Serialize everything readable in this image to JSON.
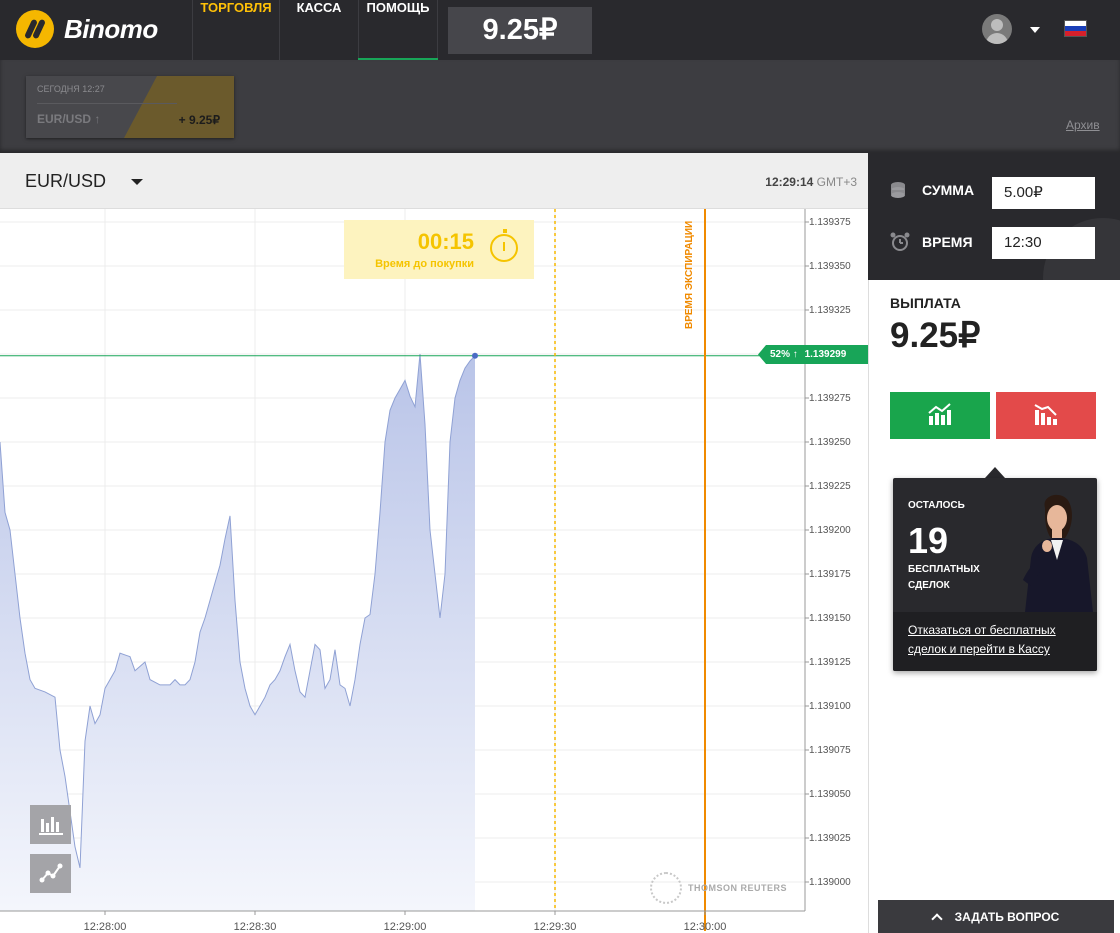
{
  "header": {
    "logo_text": "Binomo",
    "nav": [
      {
        "label": "ТОРГОВЛЯ"
      },
      {
        "label": "КАССА"
      },
      {
        "label": "ПОМОЩЬ"
      }
    ],
    "balance": "9.25₽"
  },
  "history": {
    "deal": {
      "time": "СЕГОДНЯ 12:27",
      "pair": "EUR/USD ↑",
      "profit": "+ 9.25₽"
    },
    "archive_label": "Архив"
  },
  "chart_header": {
    "pair": "EUR/USD",
    "time": "12:29:14",
    "tz": "GMT+3"
  },
  "chart": {
    "purchase_timer": {
      "value": "00:15",
      "label": "Время до покупки"
    },
    "expiration_label": "ВРЕМЯ ЭКСПИРАЦИИ",
    "price_tag": {
      "percent": "52% ↑",
      "price": "1.139299"
    },
    "watermark": "THOMSON REUTERS",
    "colors": {
      "area": "#c3cdea",
      "line": "#8fa1d4",
      "current_line": "#18a558",
      "expiry": "#f08a00",
      "purchase": "#f5b700"
    }
  },
  "chart_data": {
    "type": "area",
    "title": "",
    "xlabel": "",
    "ylabel": "",
    "ylim": [
      1.13899,
      1.139385
    ],
    "y_ticks": [
      "1.139375",
      "1.139350",
      "1.139325",
      "1.139300",
      "1.139275",
      "1.139250",
      "1.139225",
      "1.139200",
      "1.139175",
      "1.139150",
      "1.139125",
      "1.139100",
      "1.139075",
      "1.139050",
      "1.139025",
      "1.139000"
    ],
    "x_ticks": [
      "12:28:00",
      "12:28:30",
      "12:29:00",
      "12:29:30",
      "12:30:00"
    ],
    "grid": true,
    "current_price": 1.139299,
    "purchase_deadline": "12:29:30",
    "expiration_time": "12:30:00",
    "series": [
      {
        "values": [
          [
            "12:27:39",
            1.13925
          ],
          [
            "12:27:40",
            1.13921
          ],
          [
            "12:27:41",
            1.1392
          ],
          [
            "12:27:42",
            1.139175
          ],
          [
            "12:27:43",
            1.13915
          ],
          [
            "12:27:44",
            1.13913
          ],
          [
            "12:27:45",
            1.139115
          ],
          [
            "12:27:46",
            1.13911
          ],
          [
            "12:27:48",
            1.139108
          ],
          [
            "12:27:50",
            1.139105
          ],
          [
            "12:27:51",
            1.139075
          ],
          [
            "12:27:52",
            1.13906
          ],
          [
            "12:27:53",
            1.13904
          ],
          [
            "12:27:54",
            1.13902
          ],
          [
            "12:27:55",
            1.139008
          ],
          [
            "12:27:56",
            1.13908
          ],
          [
            "12:27:57",
            1.1391
          ],
          [
            "12:27:58",
            1.13909
          ],
          [
            "12:27:59",
            1.139095
          ],
          [
            "12:28:00",
            1.13911
          ],
          [
            "12:28:01",
            1.139115
          ],
          [
            "12:28:02",
            1.13912
          ],
          [
            "12:28:03",
            1.13913
          ],
          [
            "12:28:05",
            1.139128
          ],
          [
            "12:28:06",
            1.13912
          ],
          [
            "12:28:08",
            1.139125
          ],
          [
            "12:28:09",
            1.139115
          ],
          [
            "12:28:11",
            1.139112
          ],
          [
            "12:28:13",
            1.139112
          ],
          [
            "12:28:14",
            1.139115
          ],
          [
            "12:28:15",
            1.139112
          ],
          [
            "12:28:16",
            1.139112
          ],
          [
            "12:28:17",
            1.139115
          ],
          [
            "12:28:18",
            1.139125
          ],
          [
            "12:28:19",
            1.139142
          ],
          [
            "12:28:20",
            1.13915
          ],
          [
            "12:28:21",
            1.13916
          ],
          [
            "12:28:22",
            1.13917
          ],
          [
            "12:28:23",
            1.13918
          ],
          [
            "12:28:24",
            1.139195
          ],
          [
            "12:28:25",
            1.139208
          ],
          [
            "12:28:26",
            1.13916
          ],
          [
            "12:28:27",
            1.139125
          ],
          [
            "12:28:28",
            1.13911
          ],
          [
            "12:28:29",
            1.1391
          ],
          [
            "12:28:30",
            1.139095
          ],
          [
            "12:28:31",
            1.1391
          ],
          [
            "12:28:32",
            1.139105
          ],
          [
            "12:28:33",
            1.139112
          ],
          [
            "12:28:34",
            1.139115
          ],
          [
            "12:28:35",
            1.13912
          ],
          [
            "12:28:36",
            1.139128
          ],
          [
            "12:28:37",
            1.139135
          ],
          [
            "12:28:38",
            1.13912
          ],
          [
            "12:28:39",
            1.139108
          ],
          [
            "12:28:40",
            1.139105
          ],
          [
            "12:28:41",
            1.13912
          ],
          [
            "12:28:42",
            1.139135
          ],
          [
            "12:28:43",
            1.139132
          ],
          [
            "12:28:44",
            1.13911
          ],
          [
            "12:28:45",
            1.139115
          ],
          [
            "12:28:46",
            1.139132
          ],
          [
            "12:28:47",
            1.139112
          ],
          [
            "12:28:48",
            1.13911
          ],
          [
            "12:28:49",
            1.1391
          ],
          [
            "12:28:50",
            1.139115
          ],
          [
            "12:28:51",
            1.139135
          ],
          [
            "12:28:52",
            1.13915
          ],
          [
            "12:28:53",
            1.139152
          ],
          [
            "12:28:54",
            1.139175
          ],
          [
            "12:28:55",
            1.13921
          ],
          [
            "12:28:56",
            1.13925
          ],
          [
            "12:28:57",
            1.139268
          ],
          [
            "12:28:58",
            1.139275
          ],
          [
            "12:28:59",
            1.13928
          ],
          [
            "12:29:00",
            1.139285
          ],
          [
            "12:29:01",
            1.139276
          ],
          [
            "12:29:02",
            1.13927
          ],
          [
            "12:29:03",
            1.1393
          ],
          [
            "12:29:04",
            1.13926
          ],
          [
            "12:29:05",
            1.1392
          ],
          [
            "12:29:06",
            1.139175
          ],
          [
            "12:29:07",
            1.13915
          ],
          [
            "12:29:08",
            1.139175
          ],
          [
            "12:29:09",
            1.13925
          ],
          [
            "12:29:10",
            1.139275
          ],
          [
            "12:29:11",
            1.139285
          ],
          [
            "12:29:12",
            1.139292
          ],
          [
            "12:29:13",
            1.139296
          ],
          [
            "12:29:14",
            1.139299
          ]
        ]
      }
    ]
  },
  "side": {
    "amount_label": "СУММА",
    "amount_value": "5.00₽",
    "time_label": "ВРЕМЯ",
    "time_value": "12:30",
    "payout_label": "ВЫПЛАТА",
    "payout_value": "9.25₽"
  },
  "promo": {
    "remaining_label": "ОСТАЛОСЬ",
    "count": "19",
    "sub_label": "БЕСПЛАТНЫХ СДЕЛОК",
    "link": "Отказаться от бесплатных сделок и перейти в Кассу"
  },
  "ask_button": "ЗАДАТЬ ВОПРОС"
}
